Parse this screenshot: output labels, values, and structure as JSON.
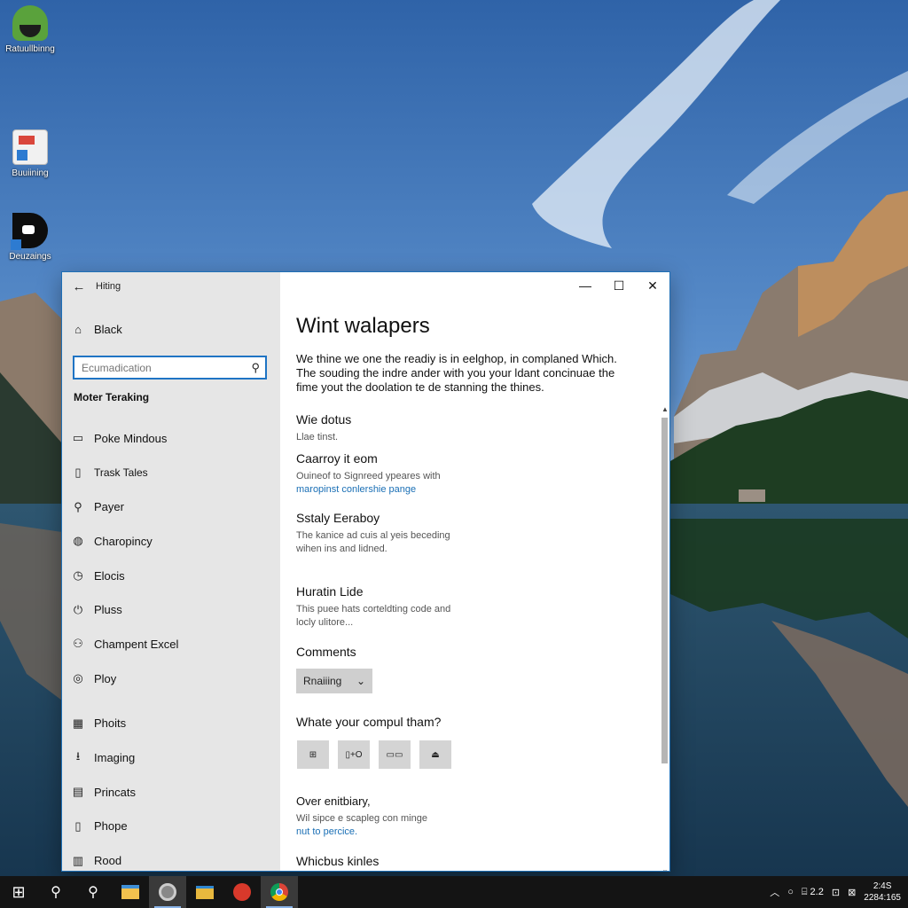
{
  "desktop": {
    "icons": [
      {
        "label": "Ratuullbinng",
        "icon": "android-app-icon"
      },
      {
        "label": "Buuiining",
        "icon": "document-app-icon"
      },
      {
        "label": "Deuzaings",
        "icon": "black-app-icon"
      }
    ]
  },
  "window": {
    "title": "Hiting",
    "back_glyph": "←",
    "controls": {
      "minimize": "—",
      "maximize": "☐",
      "close": "✕"
    },
    "nav": {
      "home": {
        "label": "Black",
        "icon": "home-icon",
        "glyph": "⌂"
      },
      "search": {
        "placeholder": "Ecumadication",
        "icon": "search-icon",
        "glyph": "⚲"
      },
      "section_heading": "Moter Teraking",
      "items": [
        {
          "label": "Poke Mindous",
          "icon": "display-icon",
          "glyph": "▭"
        },
        {
          "label": "Trask Tales",
          "icon": "tablet-icon",
          "glyph": "▯"
        },
        {
          "label": "Payer",
          "icon": "search-icon",
          "glyph": "⚲"
        },
        {
          "label": "Charopincy",
          "icon": "map-pin-icon",
          "glyph": "◍"
        },
        {
          "label": "Elocis",
          "icon": "clock-icon",
          "glyph": "◷"
        },
        {
          "label": "Pluss",
          "icon": "power-icon",
          "glyph": "⏻"
        },
        {
          "label": "Champent Excel",
          "icon": "person-icon",
          "glyph": "⚇"
        },
        {
          "label": "Ploy",
          "icon": "gamepad-icon",
          "glyph": "◎"
        },
        {
          "label": "Phoits",
          "icon": "photo-icon",
          "glyph": "▦"
        },
        {
          "label": "Imaging",
          "icon": "download-icon",
          "glyph": "⭳"
        },
        {
          "label": "Princats",
          "icon": "printer-icon",
          "glyph": "▤"
        },
        {
          "label": "Phope",
          "icon": "phone-icon",
          "glyph": "▯"
        },
        {
          "label": "Rood",
          "icon": "book-icon",
          "glyph": "▥"
        }
      ]
    },
    "content": {
      "title": "Wint walapers",
      "intro": "We thine we one the readiy is in eelghop, in complaned Which. The souding the indre ander with you your ldant concinuae the fime yout the doolation te de stanning the thines.",
      "blocks": [
        {
          "heading": "Wie dotus",
          "sub": "Llae tinst."
        },
        {
          "heading": "Caarroy it eom",
          "sub": "Ouineof to Signreed ypeares with",
          "link": "maropinst conlershie pange"
        },
        {
          "heading": "Sstaly Eeraboy",
          "sub": "The kanice ad cuis al yeis beceding wihen ins and lidned."
        },
        {
          "heading": "Huratin Lide",
          "sub": "This puee hats corteldting code and locly ulitore..."
        },
        {
          "heading": "Comments"
        }
      ],
      "dropdown": {
        "value": "Rnaiiing",
        "icon": "chevron-down-icon",
        "glyph": "⌄"
      },
      "question": "Whate your compul tham?",
      "buttons": [
        {
          "label": "⊞",
          "icon": "grid-icon"
        },
        {
          "label": "▯+O",
          "icon": "device-icon"
        },
        {
          "label": "▭▭",
          "icon": "keyboard-icon"
        },
        {
          "label": "⏏",
          "icon": "eject-icon"
        }
      ],
      "over": {
        "heading": "Over enitbiary,",
        "sub": "Wil sipce e scapleg con minge",
        "link": "nut to percice."
      },
      "last_heading": "Whicbus kinles"
    }
  },
  "taskbar": {
    "start": {
      "icon": "windows-start-icon",
      "glyph": "⊞"
    },
    "apps": [
      {
        "icon": "search-icon",
        "glyph": "⚲"
      },
      {
        "icon": "search-icon",
        "glyph": "⚲"
      },
      {
        "icon": "file-explorer-icon",
        "glyph": "▀"
      },
      {
        "icon": "settings-app-icon",
        "glyph": "◉"
      },
      {
        "icon": "folder-icon",
        "glyph": "▬"
      },
      {
        "icon": "red-app-icon",
        "glyph": "●"
      },
      {
        "icon": "chrome-icon",
        "glyph": "◎"
      }
    ],
    "tray": {
      "chevron": "︿",
      "items": [
        "○",
        "⌸ 2.2",
        "⊡",
        "⊠"
      ],
      "clock_time": "2:4S",
      "clock_date": "2284:165"
    },
    "colors": {
      "accent": "#1f74c4",
      "link": "#1a6fb5"
    }
  }
}
